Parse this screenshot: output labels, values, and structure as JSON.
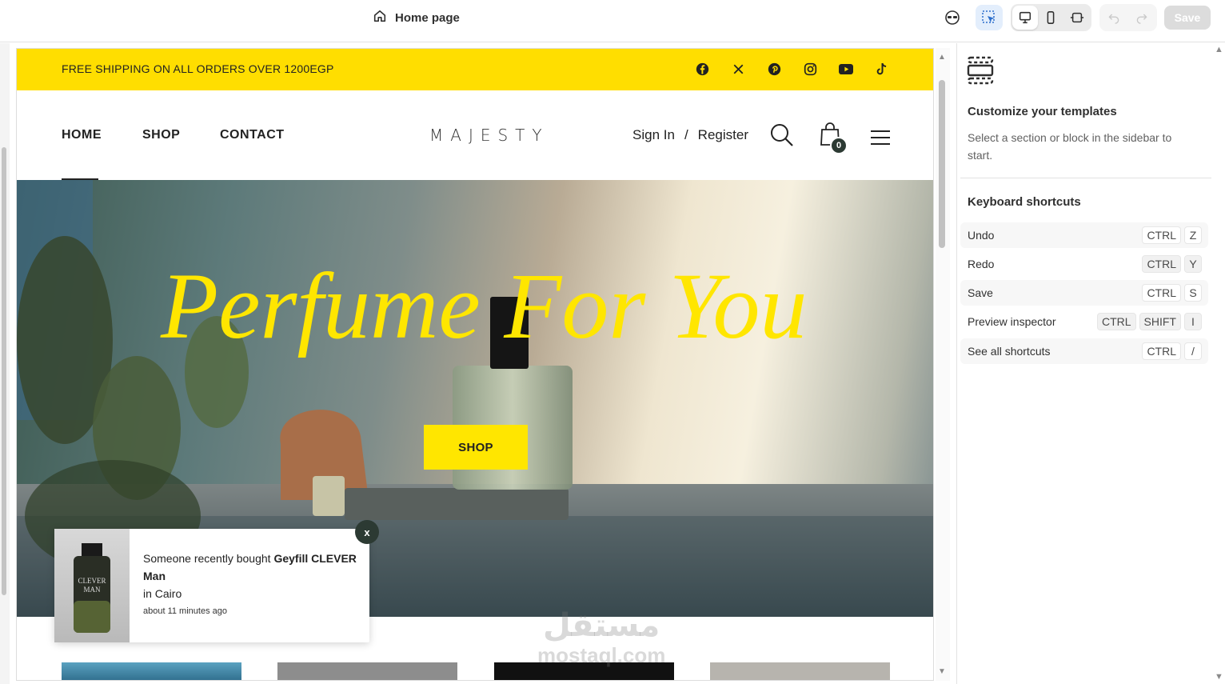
{
  "topbar": {
    "title": "Home page",
    "save_label": "Save",
    "icons": [
      "home-icon",
      "sunglasses-icon",
      "select-cursor-icon",
      "desktop-icon",
      "mobile-icon",
      "fullwidth-icon",
      "undo-icon",
      "redo-icon"
    ]
  },
  "announcement": {
    "text": "FREE SHIPPING ON ALL ORDERS OVER 1200EGP",
    "background": "#ffde00",
    "socials": [
      "facebook-icon",
      "x-icon",
      "pinterest-icon",
      "instagram-icon",
      "youtube-icon",
      "tiktok-icon"
    ]
  },
  "header": {
    "nav": [
      "HOME",
      "SHOP",
      "CONTACT"
    ],
    "logo": "MAJESTY",
    "sign_in": "Sign In",
    "separator": "/",
    "register": "Register",
    "cart_count": "0"
  },
  "hero": {
    "title": "Perfume For You",
    "button": "SHOP",
    "accent": "#ffe600"
  },
  "toast": {
    "prefix": "Someone recently bought ",
    "product": "Geyfill CLEVER Man",
    "location": "in Cairo",
    "time_ago": "about 11 minutes ago",
    "image_label_1": "CLEVER",
    "image_label_2": "MAN",
    "close": "x"
  },
  "sidebar": {
    "title": "Customize your templates",
    "description": "Select a section or block in the sidebar to start.",
    "shortcuts_title": "Keyboard shortcuts",
    "shortcuts": [
      {
        "label": "Undo",
        "keys": [
          "CTRL",
          "Z"
        ]
      },
      {
        "label": "Redo",
        "keys": [
          "CTRL",
          "Y"
        ]
      },
      {
        "label": "Save",
        "keys": [
          "CTRL",
          "S"
        ]
      },
      {
        "label": "Preview inspector",
        "keys": [
          "CTRL",
          "SHIFT",
          "I"
        ]
      },
      {
        "label": "See all shortcuts",
        "keys": [
          "CTRL",
          "/"
        ]
      }
    ]
  },
  "watermark": {
    "latin": "mostaql.com"
  }
}
